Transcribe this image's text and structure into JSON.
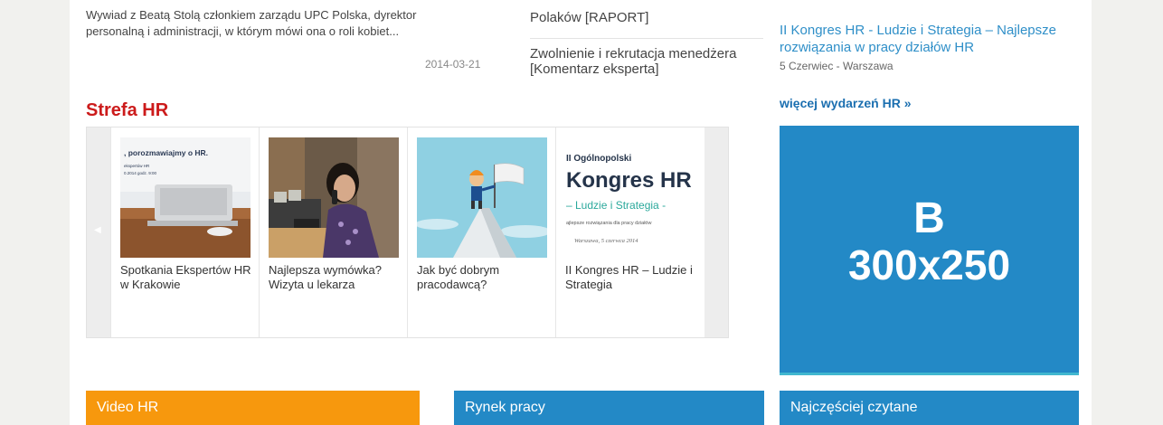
{
  "lead": {
    "text": "Wywiad z Beatą Stolą członkiem zarządu UPC Polska, dyrektor personalną i administracji, w którym mówi ona o roli kobiet...",
    "date": "2014-03-21"
  },
  "middle_list": [
    "Polaków [RAPORT]",
    "Zwolnienie i rekrutacja menedżera [Komentarz eksperta]"
  ],
  "events": {
    "title": "II Kongres HR - Ludzie i Strategia – Najlepsze rozwiązania w pracy działów HR",
    "meta": "5 Czerwiec - Warszawa",
    "more_link": "więcej wydarzeń HR »"
  },
  "strefa": {
    "title": "Strefa HR",
    "items": [
      {
        "label": "Spotkania Ekspertów HR w Krakowie",
        "thumb_text_1": ", porozmawiajmy o HR.",
        "thumb_text_2": "ekspertów HR",
        "thumb_text_3": "0.2014 godz. 9:00"
      },
      {
        "label": "Najlepsza wymówka? Wizyta u lekarza"
      },
      {
        "label": "Jak być dobrym pracodawcą?"
      },
      {
        "label": "II Kongres HR – Ludzie i Strategia",
        "thumb_line_1": "II Ogólnopolski",
        "thumb_line_2": "Kongres HR",
        "thumb_line_3": "– Ludzie i Strategia -",
        "thumb_line_4": "ajlepsze rozwiązania dla pracy działów",
        "thumb_line_5": "Warszawa, 5 czerwca 2014"
      }
    ]
  },
  "ad": {
    "letter": "B",
    "size": "300x250"
  },
  "sections": {
    "video": "Video HR",
    "rynek": "Rynek pracy",
    "najczesciej": "Najczęściej czytane"
  },
  "colors": {
    "orange": "#f7980d",
    "blue": "#2389c6",
    "red": "#cc1b1b",
    "link": "#2f8fc8"
  }
}
